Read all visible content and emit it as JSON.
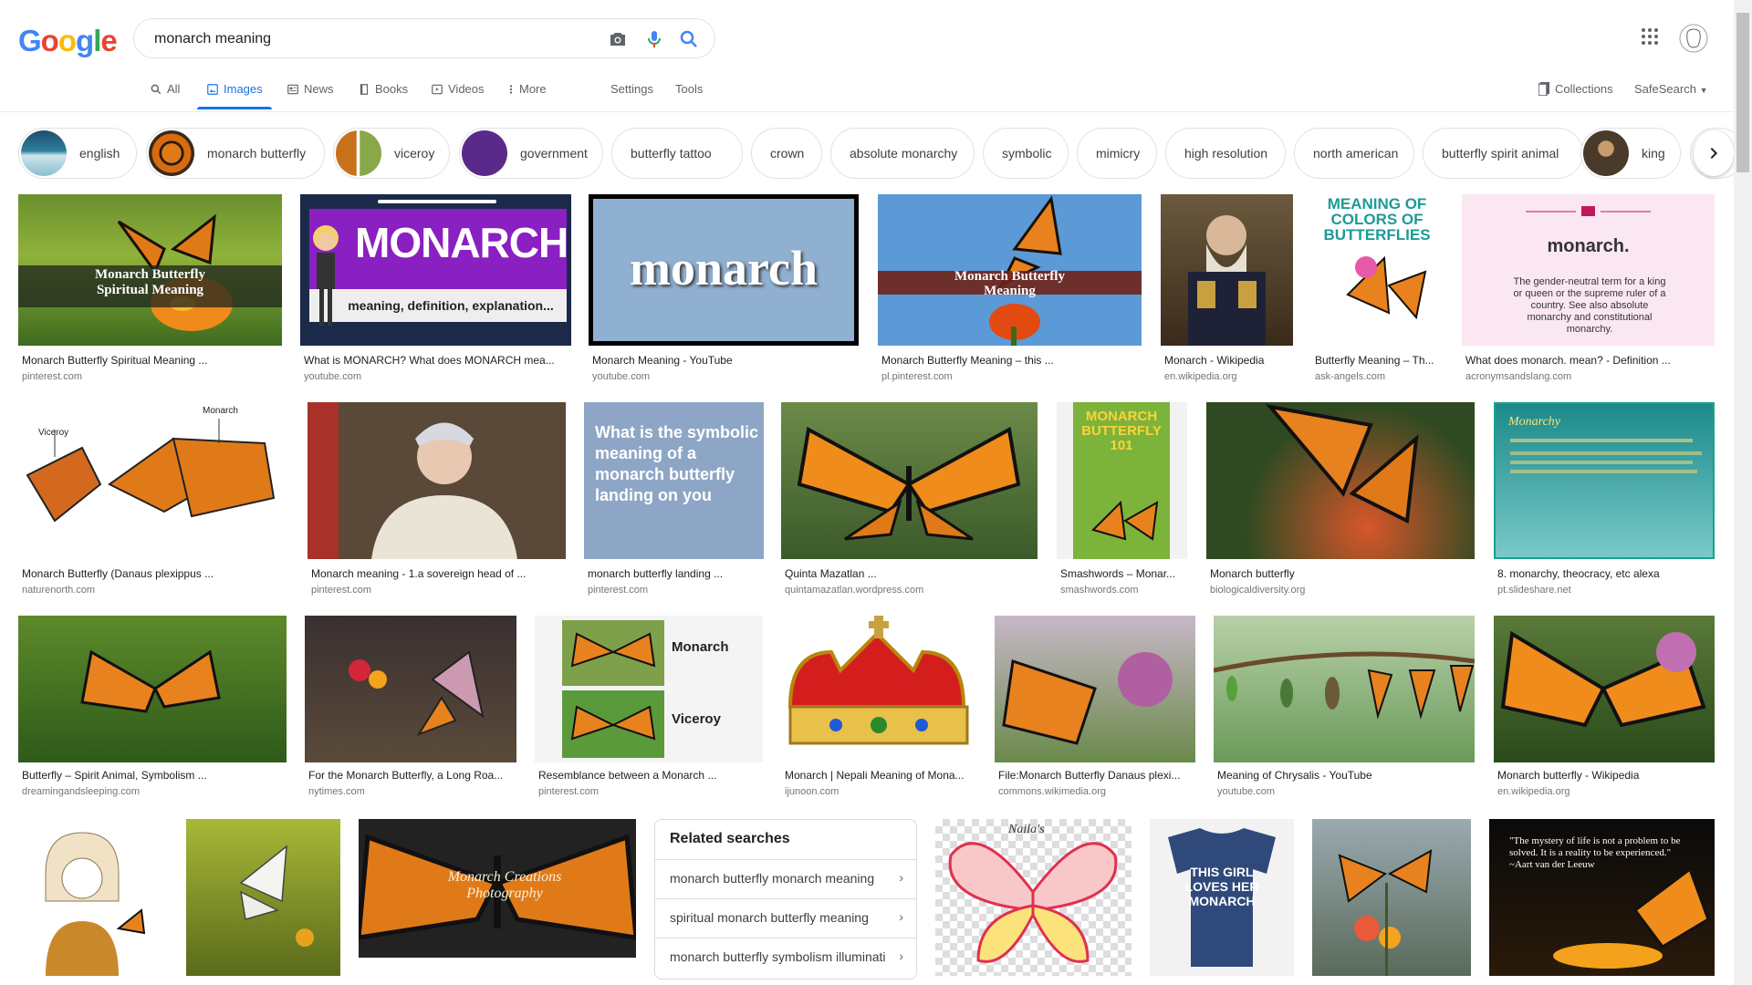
{
  "logo": {
    "letters": [
      "G",
      "o",
      "o",
      "g",
      "l",
      "e"
    ],
    "colors": [
      "#4285f4",
      "#ea4335",
      "#fbbc05",
      "#4285f4",
      "#34a853",
      "#ea4335"
    ]
  },
  "search": {
    "value": "monarch meaning",
    "placeholder": ""
  },
  "tabs": [
    {
      "label": "All",
      "icon": "search-icon"
    },
    {
      "label": "Images",
      "icon": "image-icon",
      "active": true
    },
    {
      "label": "News",
      "icon": "news-icon"
    },
    {
      "label": "Books",
      "icon": "book-icon"
    },
    {
      "label": "Videos",
      "icon": "video-icon"
    },
    {
      "label": "More",
      "icon": "more-vert-icon"
    },
    {
      "label": "Settings"
    },
    {
      "label": "Tools"
    }
  ],
  "right_tools": {
    "collections": "Collections",
    "safesearch": "SafeSearch"
  },
  "chips": [
    {
      "label": "english",
      "thumb": true
    },
    {
      "label": "monarch butterfly",
      "thumb": true
    },
    {
      "label": "viceroy",
      "thumb": true
    },
    {
      "label": "government",
      "thumb": true
    },
    {
      "label": "butterfly tattoo"
    },
    {
      "label": "crown"
    },
    {
      "label": "absolute monarchy"
    },
    {
      "label": "symbolic"
    },
    {
      "label": "mimicry"
    },
    {
      "label": "high resolution"
    },
    {
      "label": "north american"
    },
    {
      "label": "butterfly spirit animal"
    },
    {
      "label": "king",
      "thumb": true
    }
  ],
  "results": [
    {
      "caption": "Monarch Butterfly Spiritual Meaning ...",
      "source": "pinterest.com",
      "overlay": "Monarch Butterfly\nSpiritual Meaning"
    },
    {
      "caption": "What is MONARCH? What does MONARCH mea...",
      "source": "youtube.com",
      "overlay": "MONARCH",
      "overlay2": "meaning, definition, explanation..."
    },
    {
      "caption": "Monarch Meaning - YouTube",
      "source": "youtube.com",
      "overlay": "monarch"
    },
    {
      "caption": "Monarch Butterfly Meaning – this ...",
      "source": "pl.pinterest.com",
      "overlay": "Monarch Butterfly\nMeaning"
    },
    {
      "caption": "Monarch - Wikipedia",
      "source": "en.wikipedia.org"
    },
    {
      "caption": "Butterfly Meaning – Th...",
      "source": "ask-angels.com",
      "overlay": "MEANING OF COLORS OF BUTTERFLIES"
    },
    {
      "caption": "What does monarch. mean? - Definition ...",
      "source": "acronymsandslang.com",
      "overlay": "monarch.",
      "overlay2": "The gender-neutral term for a king or queen or the supreme ruler of a country. See also absolute monarchy and constitutional monarchy."
    },
    {
      "caption": "Monarch Butterfly (Danaus plexippus ...",
      "source": "naturenorth.com",
      "overlay": "Viceroy",
      "overlay2": "Monarch"
    },
    {
      "caption": "Monarch meaning - 1.a sovereign head of ...",
      "source": "pinterest.com"
    },
    {
      "caption": "monarch butterfly landing ...",
      "source": "pinterest.com",
      "overlay": "What is the symbolic meaning of a monarch butterfly landing on you"
    },
    {
      "caption": "Quinta Mazatlan ...",
      "source": "quintamazatlan.wordpress.com"
    },
    {
      "caption": "Smashwords – Monar...",
      "source": "smashwords.com",
      "overlay": "MONARCH BUTTERFLY 101"
    },
    {
      "caption": "Monarch butterfly",
      "source": "biologicaldiversity.org"
    },
    {
      "caption": "8. monarchy, theocracy, etc alexa",
      "source": "pt.slideshare.net",
      "overlay": "Monarchy"
    },
    {
      "caption": "Butterfly – Spirit Animal, Symbolism ...",
      "source": "dreamingandsleeping.com"
    },
    {
      "caption": "For the Monarch Butterfly, a Long Roa...",
      "source": "nytimes.com"
    },
    {
      "caption": "Resemblance between a Monarch ...",
      "source": "pinterest.com",
      "overlay": "Monarch",
      "overlay2": "Viceroy"
    },
    {
      "caption": "Monarch | Nepali Meaning of Mona...",
      "source": "ijunoon.com"
    },
    {
      "caption": "File:Monarch Butterfly Danaus plexi...",
      "source": "commons.wikimedia.org"
    },
    {
      "caption": "Meaning of Chrysalis - YouTube",
      "source": "youtube.com"
    },
    {
      "caption": "Monarch butterfly - Wikipedia",
      "source": "en.wikipedia.org"
    }
  ],
  "row4": [
    {
      "name": "illustration"
    },
    {
      "name": "white-butterfly"
    },
    {
      "name": "monarch-photography",
      "overlay": "Monarch Creations Photography"
    },
    {
      "name": "wings",
      "overlay": "Naila's"
    },
    {
      "name": "tshirt",
      "overlay": "THIS GIRL LOVES HER MONARCH"
    },
    {
      "name": "butterfly-flower"
    },
    {
      "name": "quote",
      "overlay": "\"The mystery of life is not a problem to be solved. It is a reality to be experienced.\" ~Aart van der Leeuw"
    }
  ],
  "related": {
    "title": "Related searches",
    "items": [
      "monarch butterfly monarch meaning",
      "spiritual monarch butterfly meaning",
      "monarch butterfly symbolism illuminati"
    ]
  },
  "colors": {
    "accent": "#1a73e8",
    "monarch_orange": "#e8821e",
    "purple": "#8a1fc2"
  }
}
